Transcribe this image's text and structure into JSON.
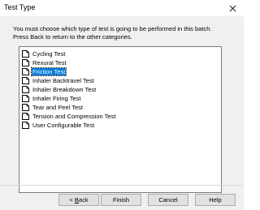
{
  "window": {
    "title": "Test Type",
    "close_glyph": "close-icon"
  },
  "instructions": {
    "line1": "You must choose which type of test is going to be performed in this batch.",
    "line2": "Press Back to return to the other categories."
  },
  "test_list": {
    "selected_index": 2,
    "items": [
      {
        "label": "Cycling Test",
        "icon": "document-icon"
      },
      {
        "label": "Rexural Test",
        "icon": "document-icon"
      },
      {
        "label": "Friction Test",
        "icon": "document-icon"
      },
      {
        "label": "Inhaler Backtravel Test",
        "icon": "document-icon"
      },
      {
        "label": "Inhaler Breakdown Test",
        "icon": "document-icon"
      },
      {
        "label": "Inhaler Firing Test",
        "icon": "document-icon"
      },
      {
        "label": "Tear and Peel Test",
        "icon": "document-icon"
      },
      {
        "label": "Tension and Compression Test",
        "icon": "document-icon"
      },
      {
        "label": "User Configurable Test",
        "icon": "document-icon"
      }
    ]
  },
  "buttons": {
    "back_prefix": "< ",
    "back_mnemonic": "B",
    "back_rest": "ack",
    "finish": "Finish",
    "cancel": "Cancel",
    "help": "Help"
  },
  "colors": {
    "selection": "#0078d7",
    "dialog_bg": "#f0f0f0"
  }
}
